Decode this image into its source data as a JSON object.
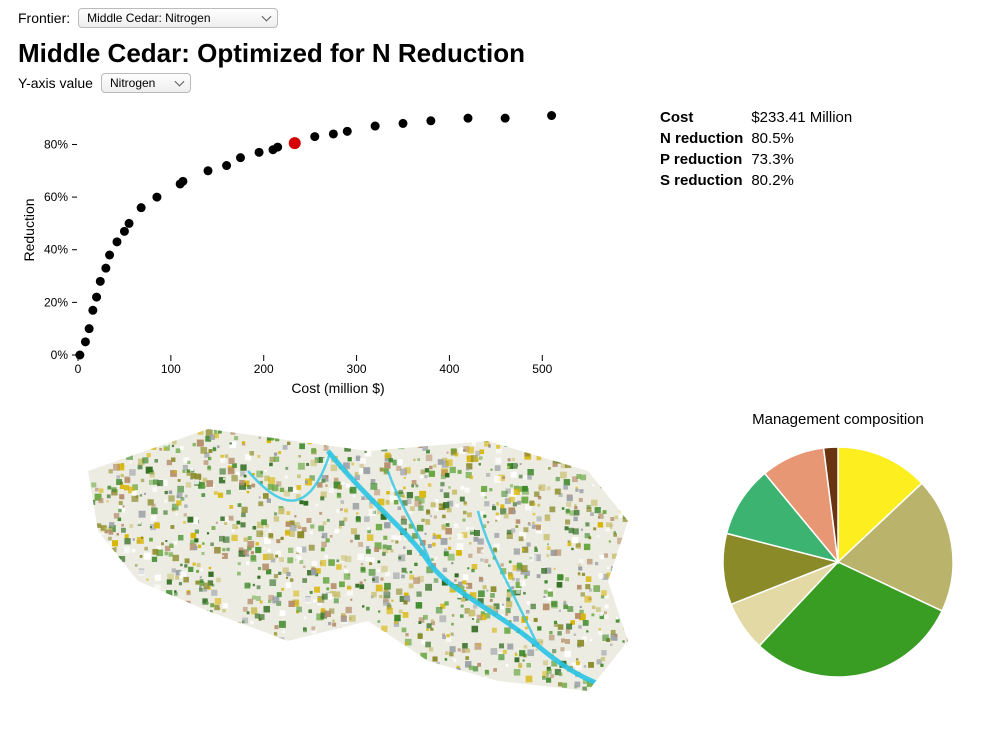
{
  "frontier": {
    "label": "Frontier:",
    "selected": "Middle Cedar: Nitrogen"
  },
  "title": "Middle Cedar: Optimized for N Reduction",
  "yaxis_control": {
    "label": "Y-axis value",
    "selected": "Nitrogen"
  },
  "stats": {
    "cost_label": "Cost",
    "cost_value": "$233.41 Million",
    "n_label": "N reduction",
    "n_value": "80.5%",
    "p_label": "P reduction",
    "p_value": "73.3%",
    "s_label": "S reduction",
    "s_value": "80.2%"
  },
  "pie_title": "Management composition",
  "chart_data": {
    "scatter": {
      "type": "scatter",
      "title": "Middle Cedar: Optimized for N Reduction",
      "xlabel": "Cost (million $)",
      "ylabel": "Reduction",
      "xlim": [
        0,
        560
      ],
      "ylim": [
        0,
        95
      ],
      "x_ticks": [
        0,
        100,
        200,
        300,
        400,
        500
      ],
      "y_ticks": [
        0,
        20,
        40,
        60,
        80
      ],
      "y_tick_labels": [
        "0%",
        "20%",
        "40%",
        "60%",
        "80%"
      ],
      "points": [
        {
          "x": 2,
          "y": 0
        },
        {
          "x": 8,
          "y": 5
        },
        {
          "x": 12,
          "y": 10
        },
        {
          "x": 16,
          "y": 17
        },
        {
          "x": 20,
          "y": 22
        },
        {
          "x": 24,
          "y": 28
        },
        {
          "x": 30,
          "y": 33
        },
        {
          "x": 34,
          "y": 38
        },
        {
          "x": 42,
          "y": 43
        },
        {
          "x": 50,
          "y": 47
        },
        {
          "x": 55,
          "y": 50
        },
        {
          "x": 68,
          "y": 56
        },
        {
          "x": 85,
          "y": 60
        },
        {
          "x": 110,
          "y": 65
        },
        {
          "x": 113,
          "y": 66
        },
        {
          "x": 140,
          "y": 70
        },
        {
          "x": 160,
          "y": 72
        },
        {
          "x": 175,
          "y": 75
        },
        {
          "x": 195,
          "y": 77
        },
        {
          "x": 210,
          "y": 78
        },
        {
          "x": 215,
          "y": 79
        },
        {
          "x": 233.41,
          "y": 80.5,
          "highlight": true
        },
        {
          "x": 255,
          "y": 83
        },
        {
          "x": 275,
          "y": 84
        },
        {
          "x": 290,
          "y": 85
        },
        {
          "x": 320,
          "y": 87
        },
        {
          "x": 350,
          "y": 88
        },
        {
          "x": 380,
          "y": 89
        },
        {
          "x": 420,
          "y": 90
        },
        {
          "x": 460,
          "y": 90
        },
        {
          "x": 510,
          "y": 91
        }
      ]
    },
    "pie": {
      "type": "pie",
      "title": "Management composition",
      "slices": [
        {
          "value": 13,
          "color": "#fcee1f"
        },
        {
          "value": 19,
          "color": "#b9b36b"
        },
        {
          "value": 30,
          "color": "#3a9d23"
        },
        {
          "value": 7,
          "color": "#e3d9a4"
        },
        {
          "value": 10,
          "color": "#8a8a28"
        },
        {
          "value": 10,
          "color": "#3cb371"
        },
        {
          "value": 9,
          "color": "#e79774"
        },
        {
          "value": 2,
          "color": "#6b3410"
        }
      ]
    }
  }
}
